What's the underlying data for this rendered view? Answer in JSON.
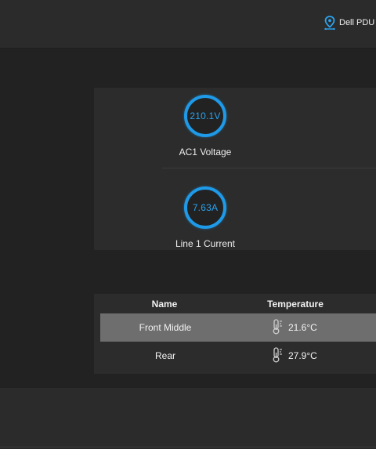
{
  "header": {
    "device_name": "Dell PDU I"
  },
  "gauges": [
    {
      "value": "210.1V",
      "label": "AC1 Voltage"
    },
    {
      "value": "7.63A",
      "label": "Line 1 Current"
    }
  ],
  "temperature_table": {
    "columns": [
      "Name",
      "Temperature"
    ],
    "rows": [
      {
        "name": "Front Middle",
        "temperature": "21.6°C",
        "selected": true
      },
      {
        "name": "Rear",
        "temperature": "27.9°C",
        "selected": false
      }
    ]
  },
  "colors": {
    "accent": "#1e9ae8",
    "background": "#222222",
    "panel": "#2c2c2c",
    "selected_row": "#6e6e6e"
  }
}
